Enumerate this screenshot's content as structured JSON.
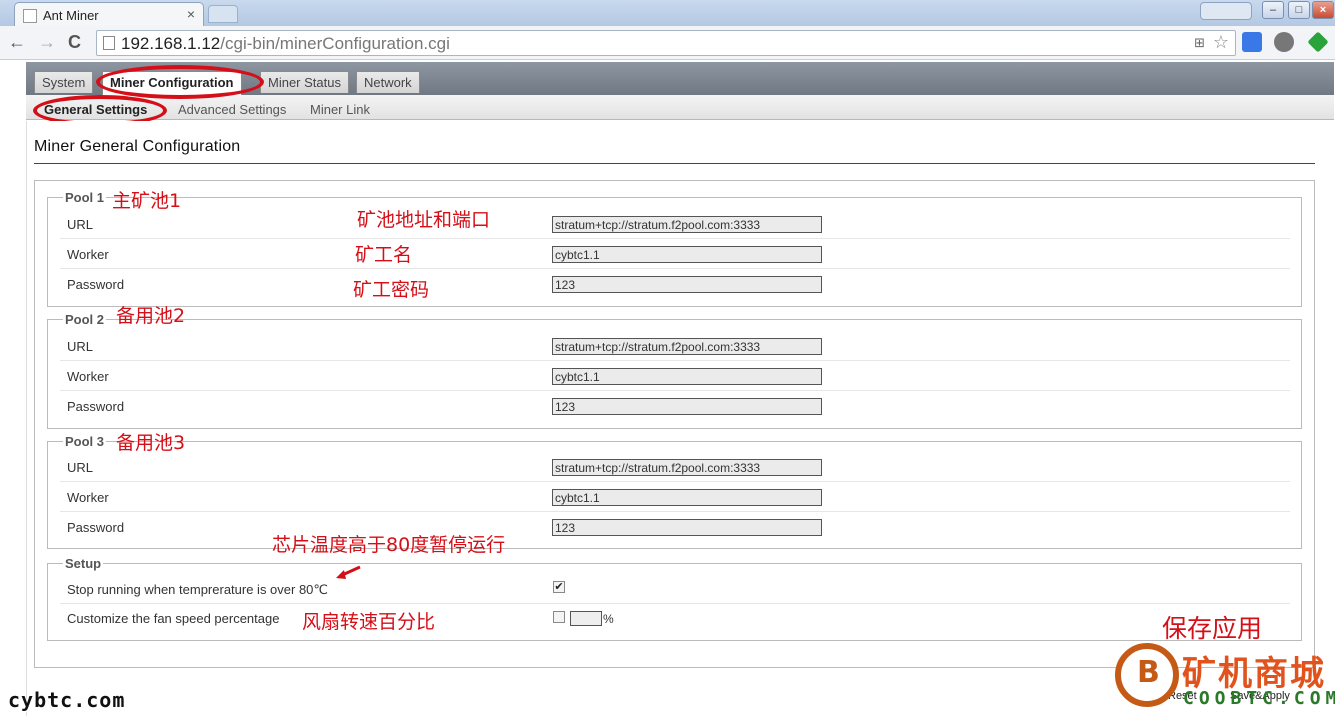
{
  "browser": {
    "tab_title": "Ant Miner",
    "tab_close": "×",
    "url_host": "192.168.1.12",
    "url_path": "/cgi-bin/minerConfiguration.cgi",
    "back": "←",
    "forward": "→",
    "reload": "C",
    "star": "☆"
  },
  "nav": {
    "main_tabs": [
      "System",
      "Miner Configuration",
      "Miner Status",
      "Network"
    ],
    "sub_tabs": [
      "General Settings",
      "Advanced Settings",
      "Miner Link"
    ]
  },
  "page": {
    "title": "Miner General Configuration"
  },
  "pools": [
    {
      "legend": "Pool 1",
      "url_label": "URL",
      "url": "stratum+tcp://stratum.f2pool.com:3333",
      "worker_label": "Worker",
      "worker": "cybtc1.1",
      "password_label": "Password",
      "password": "123",
      "annotation": "主矿池1"
    },
    {
      "legend": "Pool 2",
      "url_label": "URL",
      "url": "stratum+tcp://stratum.f2pool.com:3333",
      "worker_label": "Worker",
      "worker": "cybtc1.1",
      "password_label": "Password",
      "password": "123",
      "annotation": "备用池2"
    },
    {
      "legend": "Pool 3",
      "url_label": "URL",
      "url": "stratum+tcp://stratum.f2pool.com:3333",
      "worker_label": "Worker",
      "worker": "cybtc1.1",
      "password_label": "Password",
      "password": "123",
      "annotation": "备用池3"
    }
  ],
  "annotations": {
    "url": "矿池地址和端口",
    "worker": "矿工名",
    "password": "矿工密码",
    "temp": "芯片温度高于80度暂停运行",
    "fan": "风扇转速百分比",
    "save": "保存应用"
  },
  "setup": {
    "legend": "Setup",
    "temp_label": "Stop running when temprerature is over 80℃",
    "temp_checked": true,
    "temp_check_mark": "✔",
    "fan_label": "Customize the fan speed percentage",
    "fan_checked": false,
    "fan_unit": "%"
  },
  "buttons": {
    "reset": "Reset",
    "save_apply": "Save&Apply"
  },
  "watermark": {
    "site": "cybtc.com",
    "logo_cn": "矿机商城",
    "logo_en": "COOBTC.COM"
  },
  "colors": {
    "annotation_red": "#d40f17",
    "logo_orange": "#c55a16"
  }
}
